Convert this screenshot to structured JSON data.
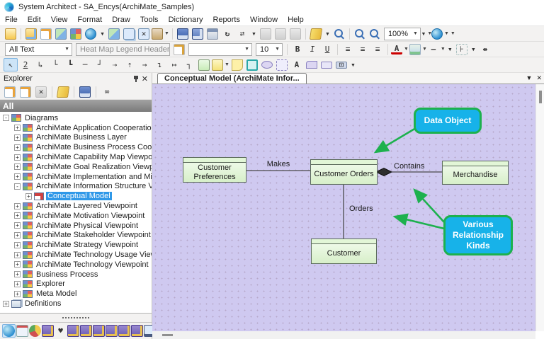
{
  "window": {
    "title": "System Architect - SA_Encys(ArchiMate_Samples)"
  },
  "menus": [
    "File",
    "Edit",
    "View",
    "Format",
    "Draw",
    "Tools",
    "Dictionary",
    "Reports",
    "Window",
    "Help"
  ],
  "toolbar_main_a": [
    {
      "name": "open-diagram-button",
      "cls": "ic-folder-open"
    },
    {
      "name": "separator",
      "cls": "sep",
      "inter": false
    },
    {
      "name": "new-definition-button",
      "cls": "ic-folder-new"
    },
    {
      "name": "edit-definition-button",
      "cls": "ic-edit"
    },
    {
      "name": "new-diagram-button",
      "cls": "ic-win-green"
    },
    {
      "name": "matrix-browser-button",
      "cls": "ic-win-multi"
    },
    {
      "name": "explorer-browser-button",
      "cls": "ic-globe"
    },
    {
      "name": "toolbar-overflow-button",
      "cls": "ovf",
      "glyph": "▾"
    },
    {
      "name": "insert-diagram-button",
      "cls": "ic-win-green"
    },
    {
      "name": "copy-diagram-button",
      "cls": "ic-win-copy"
    },
    {
      "name": "delete-diagram-button",
      "cls": "ic-win-del",
      "glyph": "✕"
    },
    {
      "name": "user-profile-button",
      "cls": "ic-user",
      "caret": true
    },
    {
      "name": "separator",
      "cls": "sep",
      "inter": false
    },
    {
      "name": "save-button",
      "cls": "ic-save"
    },
    {
      "name": "save-all-button",
      "cls": "ic-saveall"
    },
    {
      "name": "print-button",
      "cls": "ic-print"
    },
    {
      "name": "refresh-button",
      "cls": "ic-refresh",
      "glyph": "↻"
    },
    {
      "name": "link-button",
      "cls": "ic-link",
      "glyph": "⇄"
    },
    {
      "name": "toolbar-overflow-button",
      "cls": "ovf",
      "glyph": "▾"
    },
    {
      "name": "cut-button",
      "cls": "ic-gray"
    },
    {
      "name": "copy-button",
      "cls": "ic-gray"
    },
    {
      "name": "paste-button",
      "cls": "ic-gray"
    },
    {
      "name": "separator",
      "cls": "sep",
      "inter": false
    },
    {
      "name": "bookmark-button",
      "cls": "ic-book"
    },
    {
      "name": "toolbar-overflow-button",
      "cls": "ovf",
      "glyph": "▾"
    },
    {
      "name": "zoom-tool-button",
      "cls": "ic-zoom"
    },
    {
      "name": "separator",
      "cls": "sep",
      "inter": false
    },
    {
      "name": "zoom-in-button",
      "cls": "ic-zin"
    },
    {
      "name": "zoom-out-button",
      "cls": "ic-zout"
    }
  ],
  "toolbar_main_b": [
    {
      "name": "toolbar-overflow-button",
      "cls": "ovf",
      "glyph": "▾"
    },
    {
      "name": "web-publish-button",
      "cls": "ic-globe2",
      "caret": true
    }
  ],
  "toolbars": {
    "zoom_level": "100%",
    "text_scope": "All Text",
    "style_name": "Heat Map Legend Header",
    "font_name": "",
    "font_size": "10"
  },
  "toolbar_format": [
    {
      "name": "separator",
      "cls": "sep",
      "inter": false
    },
    {
      "name": "bold-button",
      "glyph": "B",
      "cls": "bold-g"
    },
    {
      "name": "italic-button",
      "glyph": "I",
      "cls": "ital-g"
    },
    {
      "name": "underline-button",
      "glyph": "U",
      "cls": "und-g"
    },
    {
      "name": "separator",
      "cls": "sep",
      "inter": false
    },
    {
      "name": "align-left-button",
      "glyph": "≡"
    },
    {
      "name": "align-center-button",
      "glyph": "≡"
    },
    {
      "name": "align-right-button",
      "glyph": "≡"
    },
    {
      "name": "separator",
      "cls": "sep",
      "inter": false
    },
    {
      "name": "font-color-button",
      "cls": "ic-fontcolor",
      "glyph": "A",
      "caret": true
    },
    {
      "name": "fill-color-button",
      "cls": "ic-fillcolor",
      "caret": true
    },
    {
      "name": "line-style-button",
      "cls": "ic-linestyle",
      "glyph": "—",
      "caret": true
    },
    {
      "name": "toolbar-overflow-button",
      "cls": "ovf",
      "glyph": "▾"
    },
    {
      "name": "distribute-button",
      "cls": "ic-distrib",
      "glyph": "⊦"
    },
    {
      "name": "toolbar-overflow-button",
      "cls": "ovf",
      "glyph": "▾"
    },
    {
      "name": "align-shapes-button",
      "cls": "ic-alignshapes",
      "glyph": "⇹"
    }
  ],
  "toolbar_draw": [
    {
      "name": "select-tool",
      "glyph": "↖",
      "cls": "pressed"
    },
    {
      "name": "reroute-line-tool",
      "glyph": "2",
      "cls": "und-g"
    },
    {
      "name": "elbow-line-tool-1",
      "glyph": "↳"
    },
    {
      "name": "elbow-line-tool-2",
      "glyph": "└"
    },
    {
      "name": "elbow-line-tool-3",
      "glyph": "┗"
    },
    {
      "name": "straight-line-tool",
      "glyph": "─"
    },
    {
      "name": "corner-line-tool",
      "glyph": "┘"
    },
    {
      "name": "dashed-arrow-tool-1",
      "glyph": "⇢"
    },
    {
      "name": "dashed-arrow-tool-2",
      "glyph": "⇡"
    },
    {
      "name": "arrow-line-tool",
      "glyph": "→"
    },
    {
      "name": "elbow-arrow-tool",
      "glyph": "↴"
    },
    {
      "name": "end-arrow-tool",
      "glyph": "↦"
    },
    {
      "name": "step-line-tool",
      "glyph": "┐"
    },
    {
      "name": "rect-green-tool",
      "cls": "sh-green"
    },
    {
      "name": "rect-yellow-tool",
      "cls": "sh-yellow",
      "caret": true
    },
    {
      "name": "note-tool",
      "cls": "sh-note"
    },
    {
      "name": "rect-teal-tool",
      "cls": "sh-teal"
    },
    {
      "name": "ellipse-tool",
      "cls": "sh-ellipse"
    },
    {
      "name": "dashed-rect-tool",
      "cls": "sh-dashed"
    },
    {
      "name": "text-tool",
      "cls": "sh-text",
      "glyph": "A"
    },
    {
      "name": "tab-shape-tool",
      "cls": "sh-tab"
    },
    {
      "name": "plain-rect-tool",
      "cls": "sh-plain"
    },
    {
      "name": "button-shape-tool",
      "cls": "sh-btn",
      "glyph": "⊡"
    },
    {
      "name": "toolbar-overflow-button",
      "cls": "ovf",
      "glyph": "▾"
    }
  ],
  "explorer": {
    "title": "Explorer",
    "group_header": "All",
    "tools": [
      {
        "name": "edit-definition-button",
        "cls": "ic-edit"
      },
      {
        "name": "edit-diagram-button",
        "cls": "ic-edit"
      },
      {
        "name": "delete-button",
        "cls": "ic-gray",
        "glyph": "✕"
      },
      {
        "name": "separator",
        "cls": "sep",
        "inter": false
      },
      {
        "name": "update-links-button",
        "cls": "ic-book",
        "glyph": ""
      },
      {
        "name": "separator",
        "cls": "sep",
        "inter": false
      },
      {
        "name": "show-diagram-button",
        "cls": "ic-save"
      },
      {
        "name": "separator",
        "cls": "sep",
        "inter": false
      },
      {
        "name": "browse-button",
        "glyph": "∞"
      }
    ],
    "tree": [
      {
        "label": "Diagrams",
        "level": 0,
        "expand": "-",
        "cls": ""
      },
      {
        "label": "ArchiMate Application Cooperation Viewpoint",
        "level": 1,
        "expand": "+",
        "cls": ""
      },
      {
        "label": "ArchiMate Business Layer",
        "level": 1,
        "expand": "+",
        "cls": ""
      },
      {
        "label": "ArchiMate Business Process Cooperation Viewp",
        "level": 1,
        "expand": "+",
        "cls": ""
      },
      {
        "label": "ArchiMate Capability Map Viewpoint",
        "level": 1,
        "expand": "+",
        "cls": ""
      },
      {
        "label": "ArchiMate Goal Realization Viewpoint",
        "level": 1,
        "expand": "+",
        "cls": ""
      },
      {
        "label": "ArchiMate Implementation and Migration Viewpo",
        "level": 1,
        "expand": "+",
        "cls": ""
      },
      {
        "label": "ArchiMate Information Structure Viewpoint",
        "level": 1,
        "expand": "-",
        "cls": ""
      },
      {
        "label": "Conceptual Model",
        "level": 2,
        "expand": "+",
        "cls": "icon-model",
        "selected": true
      },
      {
        "label": "ArchiMate Layered Viewpoint",
        "level": 1,
        "expand": "+",
        "cls": ""
      },
      {
        "label": "ArchiMate Motivation Viewpoint",
        "level": 1,
        "expand": "+",
        "cls": ""
      },
      {
        "label": "ArchiMate Physical Viewpoint",
        "level": 1,
        "expand": "+",
        "cls": ""
      },
      {
        "label": "ArchiMate Stakeholder Viewpoint",
        "level": 1,
        "expand": "+",
        "cls": ""
      },
      {
        "label": "ArchiMate Strategy Viewpoint",
        "level": 1,
        "expand": "+",
        "cls": ""
      },
      {
        "label": "ArchiMate Technology Usage Viewpoint",
        "level": 1,
        "expand": "+",
        "cls": ""
      },
      {
        "label": "ArchiMate Technology Viewpoint",
        "level": 1,
        "expand": "+",
        "cls": ""
      },
      {
        "label": "Business Process",
        "level": 1,
        "expand": "+",
        "cls": ""
      },
      {
        "label": "Explorer",
        "level": 1,
        "expand": "+",
        "cls": ""
      },
      {
        "label": "Meta Model",
        "level": 1,
        "expand": "+",
        "cls": ""
      },
      {
        "label": "Definitions",
        "level": 0,
        "expand": "+",
        "cls": "icon-defs"
      }
    ],
    "bottom_icons": [
      {
        "name": "explorer-view-button",
        "cls": "b-globe pressed"
      },
      {
        "name": "window-view-button",
        "cls": "b-window"
      },
      {
        "name": "chart-view-button",
        "cls": "b-pie"
      },
      {
        "name": "dictionary-view-button",
        "cls": "b-book"
      },
      {
        "name": "share-view-button",
        "cls": "b-share",
        "glyph": "♥"
      },
      {
        "name": "dictionary-view-button",
        "cls": "b-book"
      },
      {
        "name": "dictionary-view-button",
        "cls": "b-book"
      },
      {
        "name": "dictionary-view-button",
        "cls": "b-book"
      },
      {
        "name": "dictionary-view-button",
        "cls": "b-book"
      },
      {
        "name": "dictionary-view-button",
        "cls": "b-book"
      },
      {
        "name": "dictionary-view-button",
        "cls": "b-book"
      },
      {
        "name": "monitor-view-button",
        "cls": "b-monitor"
      },
      {
        "name": "more-views-button",
        "cls": "b-more",
        "glyph": "»"
      }
    ]
  },
  "main": {
    "tab_label": "Conceptual Model (ArchiMate Infor...",
    "tab_menu_glyph": "▼",
    "tab_close_glyph": "✕"
  },
  "diagram": {
    "nodes": [
      {
        "label": "Customer Preferences"
      },
      {
        "label": "Customer Orders"
      },
      {
        "label": "Merchandise"
      },
      {
        "label": "Customer"
      }
    ],
    "callouts": [
      {
        "label": "Data Object"
      },
      {
        "label": "Various Relationship Kinds"
      }
    ],
    "edges": {
      "makes": "Makes",
      "contains": "Contains",
      "orders": "Orders"
    }
  },
  "colors": {
    "canvas": "#cfc9f0",
    "node_fill": "#e2f6d7",
    "node_border": "#5c6b5c",
    "callout_fill": "#17b2e9",
    "callout_border": "#1db14e",
    "arrow_green": "#1db14e",
    "selection_blue": "#2f98e8"
  }
}
